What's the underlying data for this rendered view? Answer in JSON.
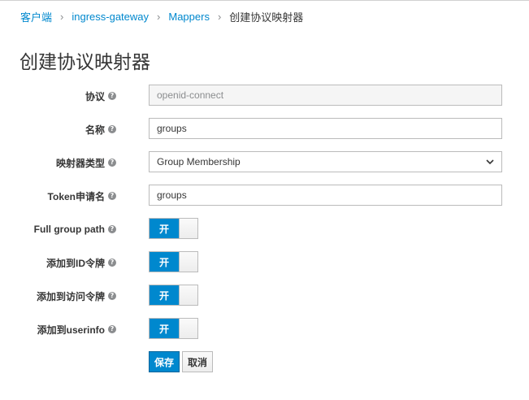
{
  "breadcrumb": {
    "items": [
      "客户端",
      "ingress-gateway",
      "Mappers"
    ],
    "current": "创建协议映射器"
  },
  "page_title": "创建协议映射器",
  "help_icon_glyph": "?",
  "form": {
    "protocol": {
      "label": "协议",
      "value": "openid-connect"
    },
    "name": {
      "label": "名称",
      "value": "groups"
    },
    "mapper_type": {
      "label": "映射器类型",
      "value": "Group Membership"
    },
    "token_claim_name": {
      "label": "Token申请名",
      "value": "groups"
    },
    "full_group_path": {
      "label": "Full group path",
      "state": "开"
    },
    "add_to_id_token": {
      "label": "添加到ID令牌",
      "state": "开"
    },
    "add_to_access_token": {
      "label": "添加到访问令牌",
      "state": "开"
    },
    "add_to_userinfo": {
      "label": "添加到userinfo",
      "state": "开"
    }
  },
  "buttons": {
    "save": "保存",
    "cancel": "取消"
  },
  "icons": {
    "help": "help-icon",
    "separator": "chevron-right-icon",
    "dropdown": "chevron-down-icon"
  },
  "colors": {
    "accent": "#0088ce",
    "link": "#0088ce"
  }
}
